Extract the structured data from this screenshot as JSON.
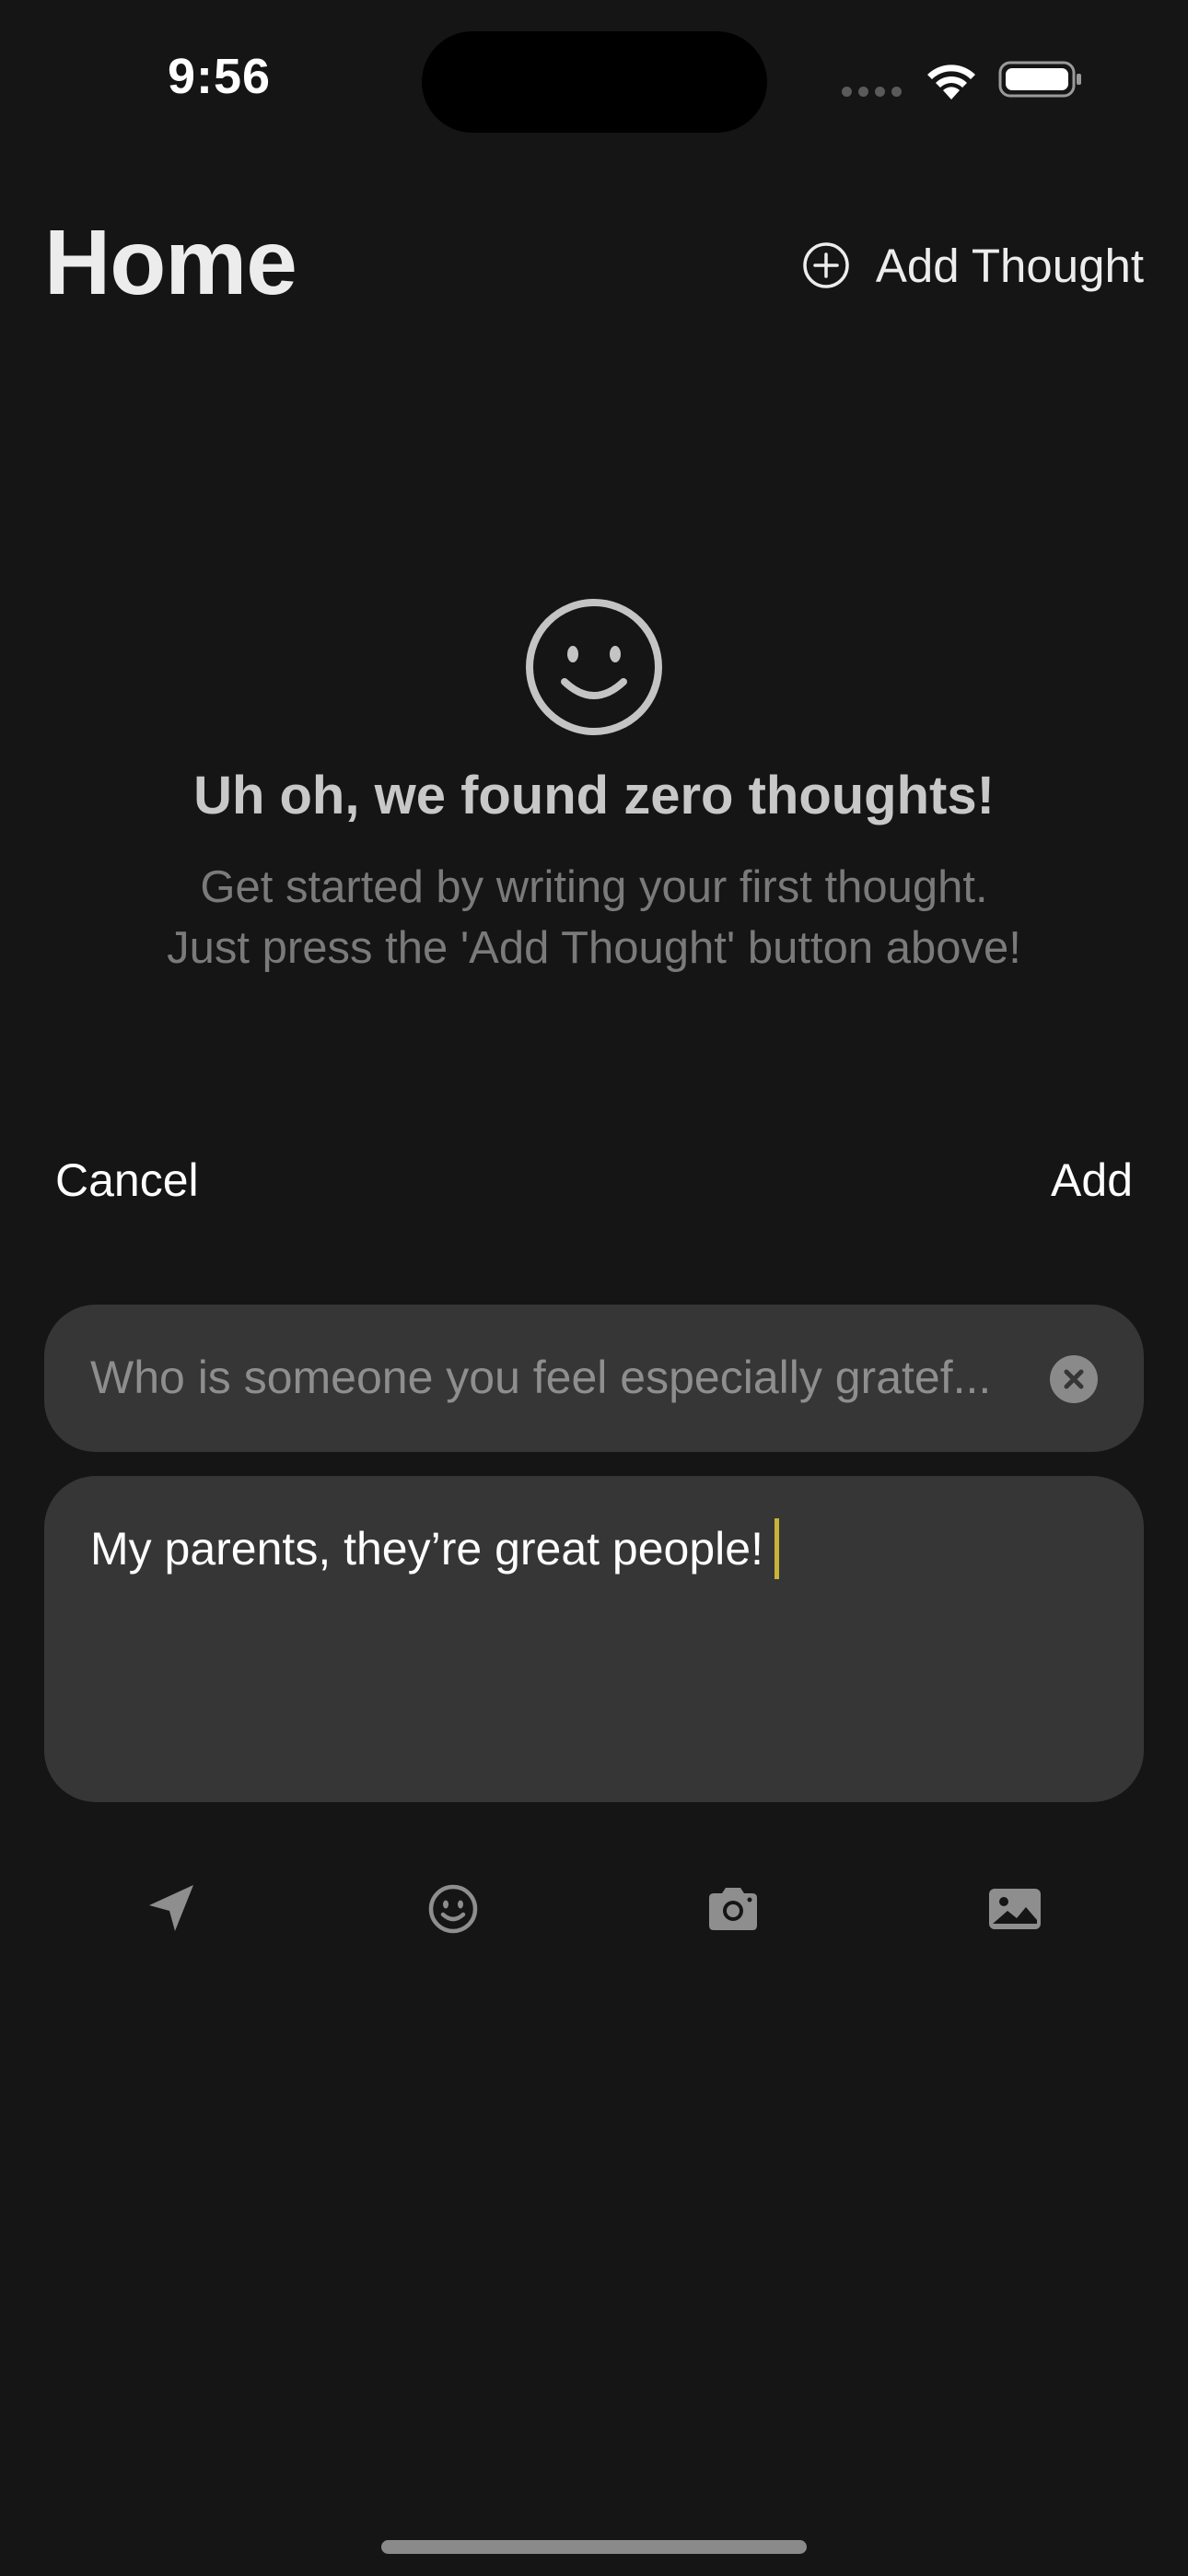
{
  "status_bar": {
    "time": "9:56"
  },
  "header": {
    "title": "Home",
    "add_thought_label": "Add Thought"
  },
  "empty_state": {
    "icon": "smiley-face-icon",
    "title": "Uh oh, we found zero thoughts!",
    "body": "Get started by writing your first thought. Just press the 'Add Thought' button above!"
  },
  "sheet": {
    "cancel_label": "Cancel",
    "add_label": "Add",
    "prompt_text": "Who is someone you feel especially gratef...",
    "answer_text": "My parents, they’re great people!"
  },
  "toolbar": {
    "icons": [
      "location-arrow-icon",
      "smiley-icon",
      "camera-icon",
      "photo-icon"
    ]
  },
  "colors": {
    "background": "#151515",
    "field": "#363636",
    "cursor": "#c8b43a"
  }
}
